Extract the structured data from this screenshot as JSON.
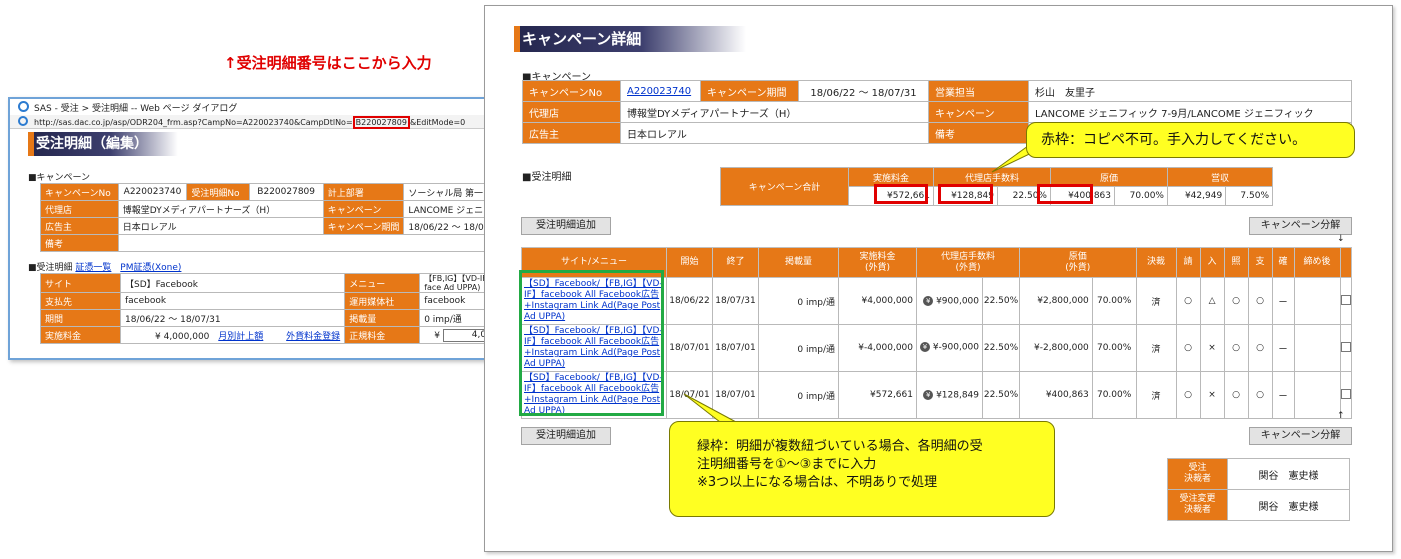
{
  "dialog": {
    "title": "SAS - 受注 > 受注明細 -- Web ページ ダイアログ",
    "url_prefix": "http://sas.dac.co.jp/asp/ODR204_frm.asp?CampNo=A220023740&CampDtlNo=",
    "url_highlight": "B220027809",
    "url_suffix": "&EditMode=0",
    "heading": "受注明細（編集）",
    "annotation": "↑受注明細番号はここから入力",
    "campaign_label": "■キャンペーン",
    "rows": [
      [
        "キャンペーンNo",
        "A220023740",
        "受注明細No",
        "B220027809",
        "計上部署",
        "ソーシャル局 第一"
      ],
      [
        "代理店",
        "博報堂DYメディアパートナーズ（H）",
        "",
        "",
        "キャンペーン",
        "LANCOME ジェニフィ"
      ],
      [
        "広告主",
        "日本ロレアル",
        "",
        "",
        "キャンペーン期間",
        "18/06/22 〜 18/07"
      ],
      [
        "備考",
        "",
        "",
        "",
        "",
        ""
      ]
    ],
    "detail_label": "■受注明細",
    "detail_link1": "証憑一覧",
    "detail_link2": "PM証憑(Xone)",
    "detail_rows": [
      [
        "サイト",
        "【SD】Facebook",
        "メニュー",
        "【FB,IG】【VD-IF】face Ad UPPA)"
      ],
      [
        "支払先",
        "facebook",
        "運用媒体社",
        "facebook"
      ],
      [
        "期間",
        "18/06/22 〜 18/07/31",
        "掲載量",
        "0 imp/通"
      ],
      [
        "実施料金",
        "¥ 4,000,000",
        "正規料金",
        "¥"
      ]
    ],
    "link_monthly": "月別計上額",
    "link_foreign": "外貨料金登録",
    "amount_right": "4,00"
  },
  "main": {
    "heading": "キャンペーン詳細",
    "campaign_label": "■キャンペーン",
    "campaign_rows": [
      {
        "l1": "キャンペーンNo",
        "v1": "A220023740",
        "l2": "キャンペーン期間",
        "v2": "18/06/22 〜 18/07/31",
        "l3": "営業担当",
        "v3": "杉山　友里子"
      },
      {
        "l1": "代理店",
        "v1": "博報堂DYメディアパートナーズ（H）",
        "l3": "キャンペーン",
        "v3": "LANCOME ジェニフィック 7-9月/LANCOME ジェニフィック"
      },
      {
        "l1": "広告主",
        "v1": "日本ロレアル",
        "l3": "備考",
        "v3": ""
      }
    ],
    "detail_label": "■受注明細",
    "summary": {
      "row_label": "キャンペーン合計",
      "headers": [
        "実施料金",
        "代理店手数料",
        "原価",
        "営収"
      ],
      "amount": "¥572,661",
      "agency_fee": "¥128,849",
      "agency_pct": "22.50%",
      "cost": "¥400,863",
      "cost_pct": "70.00%",
      "revenue": "¥42,949",
      "revenue_pct": "7.50%"
    },
    "btn_add": "受注明細追加",
    "btn_split": "キャンペーン分解",
    "table_headers": [
      "サイト/メニュー",
      "開始",
      "終了",
      "掲載量",
      "実施料金\n(外貨)",
      "代理店手数料\n(外貨)",
      "原価\n(外貨)",
      "決裁",
      "請",
      "入",
      "照",
      "支",
      "確",
      "締め後",
      ""
    ],
    "rows": [
      {
        "site": "【SD】Facebook/【FB,IG】【VD-IF】facebook All Facebook広告+Instagram Link Ad(Page Post Ad UPPA)",
        "start": "18/06/22",
        "end": "18/07/31",
        "qty": "0 imp/通",
        "amount": "¥4,000,000",
        "fee": "¥900,000",
        "fee_pct": "22.50%",
        "cost": "¥2,800,000",
        "cost_pct": "70.00%",
        "approval": "済",
        "c1": "○",
        "c2": "△",
        "c3": "○",
        "c4": "○",
        "c5": "ー"
      },
      {
        "site": "【SD】Facebook/【FB,IG】【VD-IF】facebook All Facebook広告+Instagram Link Ad(Page Post Ad UPPA)",
        "start": "18/07/01",
        "end": "18/07/01",
        "qty": "0 imp/通",
        "amount": "¥-4,000,000",
        "fee": "¥-900,000",
        "fee_pct": "22.50%",
        "cost": "¥-2,800,000",
        "cost_pct": "70.00%",
        "approval": "済",
        "c1": "○",
        "c2": "×",
        "c3": "○",
        "c4": "○",
        "c5": "ー"
      },
      {
        "site": "【SD】Facebook/【FB,IG】【VD-IF】facebook All Facebook広告+Instagram Link Ad(Page Post Ad UPPA)",
        "start": "18/07/01",
        "end": "18/07/01",
        "qty": "0 imp/通",
        "amount": "¥572,661",
        "fee": "¥128,849",
        "fee_pct": "22.50%",
        "cost": "¥400,863",
        "cost_pct": "70.00%",
        "approval": "済",
        "c1": "○",
        "c2": "×",
        "c3": "○",
        "c4": "○",
        "c5": "ー"
      }
    ],
    "arrow_up": "↑",
    "approvers": [
      {
        "role": "受注\n決裁者",
        "name": "関谷　憲史様"
      },
      {
        "role": "受注変更\n決裁者",
        "name": "関谷　憲史様"
      }
    ]
  },
  "notes": {
    "top": "赤枠：コピペ不可。手入力してください。",
    "bottom_line1": "緑枠：明細が複数紐づいている場合、各明細の受",
    "bottom_line2": "注明細番号を①〜③までに入力",
    "bottom_line3": "※3つ以上になる場合は、不明ありで処理"
  },
  "colors": {
    "orange": "#e67817",
    "navy": "#24264d",
    "red": "#e00000",
    "green": "#22aa44",
    "callout": "#ffff22"
  }
}
